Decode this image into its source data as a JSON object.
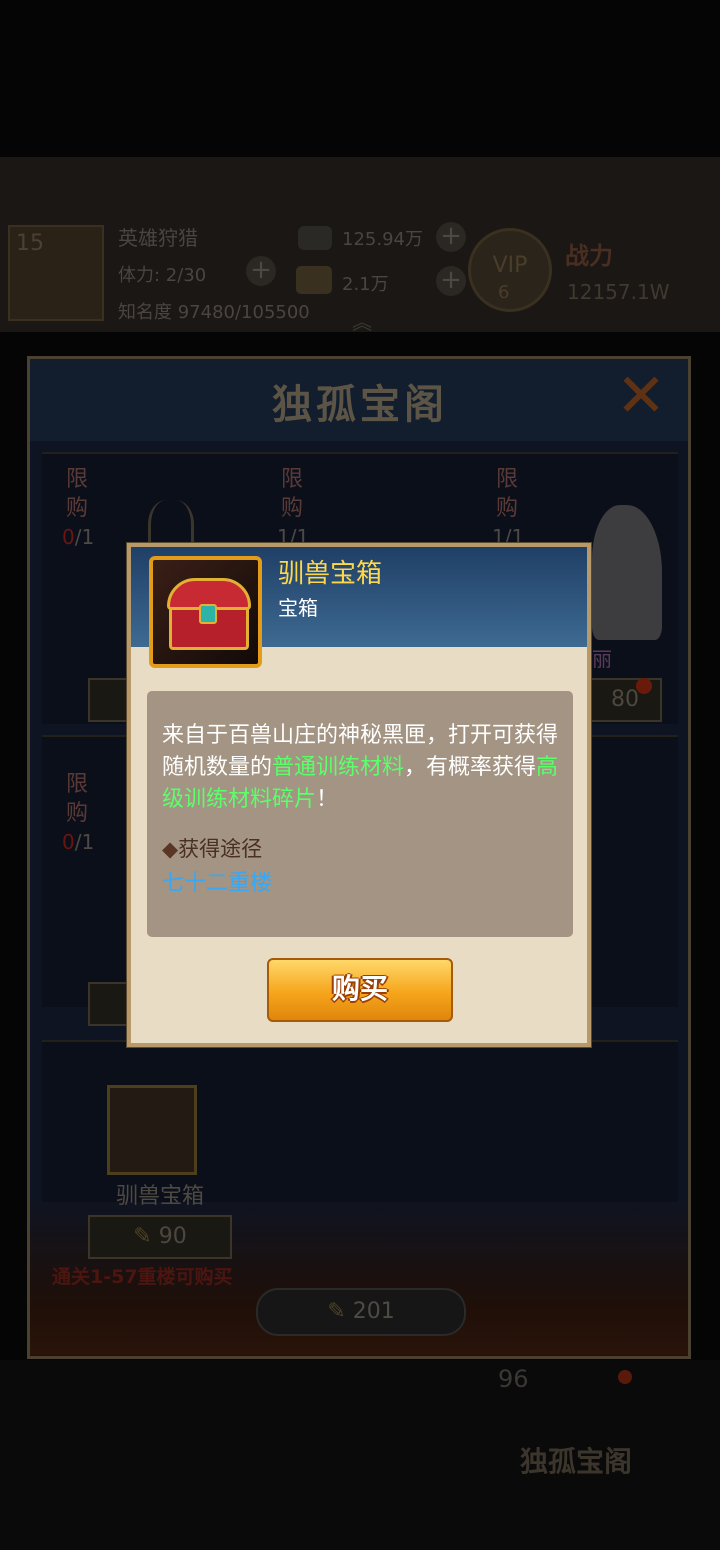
{
  "hud": {
    "level": "15",
    "mode": "英雄狩猎",
    "stamina": "体力: 2/30",
    "fame": "知名度 97480/105500",
    "silver": "125.94万",
    "gold": "2.1万",
    "vip": "VIP",
    "vip_level": "6",
    "power_label": "战力",
    "power_value": "12157.1W"
  },
  "shop": {
    "title": "独孤宝阁",
    "limit_label_1": "限",
    "limit_label_2": "购",
    "slots": [
      {
        "limit_zero": "0",
        "limit_total": "/1"
      },
      {
        "limit_count": "1/1"
      },
      {
        "limit_count": "1/1"
      },
      {
        "limit_zero": "0",
        "limit_total": "/1"
      }
    ],
    "visible_price_right": "80",
    "horse_label_fragment": "丽",
    "bottom_item_name": "驯兽宝箱",
    "bottom_item_price": "90",
    "bottom_item_requirement": "通关1-57重楼可购买",
    "total_currency": "201",
    "bottom_badge": "独孤宝阁",
    "bottom_count_fragment": "96"
  },
  "popup": {
    "item_name": "驯兽宝箱",
    "item_type": "宝箱",
    "desc_part1": "来自于百兽山庄的神秘黑匣，打开可获得随机数量的",
    "desc_highlight1": "普通训练材料",
    "desc_part2": "，有概率获得",
    "desc_highlight2": "高级训练材料碎片",
    "desc_part3": "！",
    "source_title": "获得途径",
    "source_link": "七十二重楼",
    "buy_label": "购买"
  },
  "colors": {
    "title_gold": "#ffd84a",
    "highlight_green": "#5bff6a",
    "link_blue": "#3ba7f0",
    "button_orange": "#f5a51b"
  }
}
